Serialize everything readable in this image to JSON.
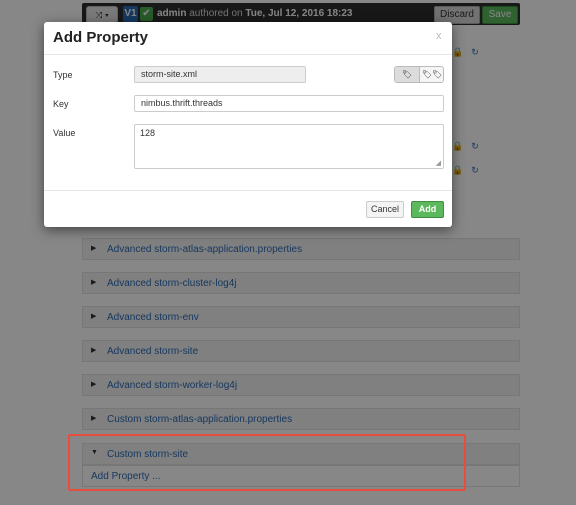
{
  "topbar": {
    "shuffle_label": "⤨ ▾",
    "version": "V1",
    "check": "✔",
    "author_user": "admin",
    "author_mid": " authored on ",
    "author_date": "Tue, Jul 12, 2016 18:23",
    "discard_label": "Discard",
    "save_label": "Save"
  },
  "bg_icons": {
    "lock": "🔒",
    "refresh": "↻"
  },
  "sections": [
    {
      "caret": "▶",
      "label": "Advanced storm-atlas-application.properties"
    },
    {
      "caret": "▶",
      "label": "Advanced storm-cluster-log4j"
    },
    {
      "caret": "▶",
      "label": "Advanced storm-env"
    },
    {
      "caret": "▶",
      "label": "Advanced storm-site"
    },
    {
      "caret": "▶",
      "label": "Advanced storm-worker-log4j"
    },
    {
      "caret": "▶",
      "label": "Custom storm-atlas-application.properties"
    },
    {
      "caret": "▼",
      "label": "Custom storm-site"
    }
  ],
  "expanded": {
    "add_property_link": "Add Property ..."
  },
  "modal": {
    "title": "Add Property",
    "close": "x",
    "type_label": "Type",
    "type_value": "storm-site.xml",
    "key_label": "Key",
    "key_value": "nimbus.thrift.threads",
    "value_label": "Value",
    "value_value": "128",
    "tag_single": "🏷",
    "tag_multi": "🏷🏷",
    "cancel_label": "Cancel",
    "add_label": "Add"
  },
  "colors": {
    "accent": "#2a6bb5",
    "success": "#5cb85c",
    "highlight": "#e74c3c"
  }
}
